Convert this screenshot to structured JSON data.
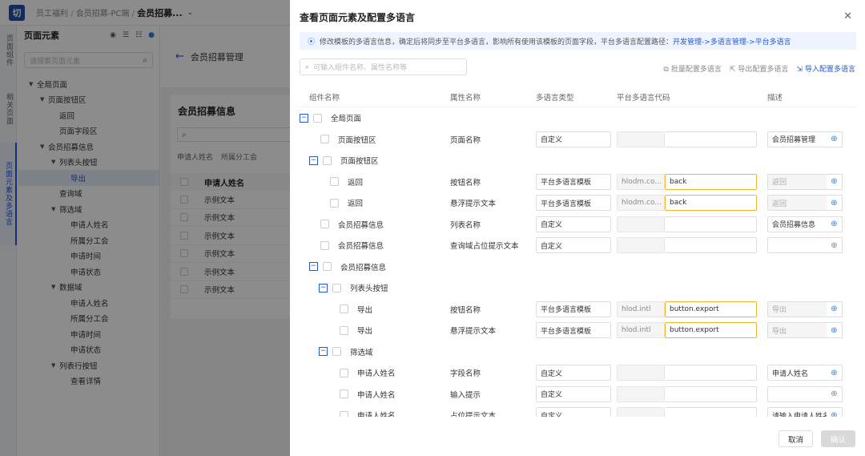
{
  "topbar": {
    "logo": "切",
    "breadcrumb": [
      "员工福利",
      "会员招募-PC端"
    ],
    "current": "会员招募..."
  },
  "vtabs": [
    {
      "label": "页面组件",
      "active": false
    },
    {
      "label": "相关页面",
      "active": false
    },
    {
      "label": "页面元素及多语言",
      "active": true
    }
  ],
  "tree": {
    "title": "页面元素",
    "search_placeholder": "请搜索页面元素",
    "nodes": [
      {
        "label": "全局页面",
        "level": 0,
        "arrow": "▼"
      },
      {
        "label": "页面按钮区",
        "level": 1,
        "arrow": "▼"
      },
      {
        "label": "返回",
        "level": 2,
        "arrow": ""
      },
      {
        "label": "页面字段区",
        "level": 2,
        "arrow": ""
      },
      {
        "label": "会员招募信息",
        "level": 1,
        "arrow": "▼"
      },
      {
        "label": "列表头按钮",
        "level": 2,
        "arrow": "▼"
      },
      {
        "label": "导出",
        "level": 3,
        "arrow": "",
        "selected": true
      },
      {
        "label": "查询域",
        "level": 2,
        "arrow": ""
      },
      {
        "label": "筛选域",
        "level": 2,
        "arrow": "▼"
      },
      {
        "label": "申请人姓名",
        "level": 3,
        "arrow": ""
      },
      {
        "label": "所属分工会",
        "level": 3,
        "arrow": ""
      },
      {
        "label": "申请时间",
        "level": 3,
        "arrow": ""
      },
      {
        "label": "申请状态",
        "level": 3,
        "arrow": ""
      },
      {
        "label": "数据域",
        "level": 2,
        "arrow": "▼"
      },
      {
        "label": "申请人姓名",
        "level": 3,
        "arrow": ""
      },
      {
        "label": "所属分工会",
        "level": 3,
        "arrow": ""
      },
      {
        "label": "申请时间",
        "level": 3,
        "arrow": ""
      },
      {
        "label": "申请状态",
        "level": 3,
        "arrow": ""
      },
      {
        "label": "列表行按钮",
        "level": 2,
        "arrow": "▼"
      },
      {
        "label": "查看详情",
        "level": 3,
        "arrow": ""
      }
    ]
  },
  "main": {
    "page_title": "会员招募管理",
    "card_title": "会员招募信息",
    "filters": [
      "申请人姓名",
      "所属分工会"
    ],
    "table_header": "申请人姓名",
    "rows": [
      "示例文本",
      "示例文本",
      "示例文本",
      "示例文本",
      "示例文本",
      "示例文本"
    ]
  },
  "drawer": {
    "title": "查看页面元素及配置多语言",
    "notice": "修改模板的多语言信息，确定后将同步至平台多语言，影响所有使用该模板的页面字段，平台多语言配置路径：",
    "notice_path": "开发管理->多语言管理->平台多语言",
    "search_placeholder": "可输入组件名称、属性名称等",
    "actions": {
      "batch": "批量配置多语言",
      "export": "导出配置多语言",
      "import": "导入配置多语言"
    },
    "columns": [
      "组件名称",
      "属性名称",
      "多语言类型",
      "平台多语言代码",
      "描述"
    ],
    "rows": [
      {
        "type": "group",
        "indent": 0,
        "name": "全局页面"
      },
      {
        "type": "item",
        "indent": 1,
        "name": "页面按钮区",
        "attr": "页面名称",
        "lang": "自定义",
        "code": "",
        "val": "",
        "hl": false,
        "desc": "会员招募管理",
        "desc_dis": false,
        "globe_blue": true
      },
      {
        "type": "group",
        "indent": 1,
        "name": "页面按钮区"
      },
      {
        "type": "item",
        "indent": 2,
        "name": "返回",
        "attr": "按钮名称",
        "lang": "平台多语言模板",
        "code": "hlodm.co...",
        "val": "back",
        "hl": true,
        "desc": "返回",
        "desc_dis": true,
        "globe_blue": true
      },
      {
        "type": "item",
        "indent": 2,
        "name": "返回",
        "attr": "悬浮提示文本",
        "lang": "平台多语言模板",
        "code": "hlodm.co...",
        "val": "back",
        "hl": true,
        "desc": "返回",
        "desc_dis": true,
        "globe_blue": true
      },
      {
        "type": "item",
        "indent": 1,
        "name": "会员招募信息",
        "attr": "列表名称",
        "lang": "自定义",
        "code": "",
        "val": "",
        "hl": false,
        "desc": "会员招募信息",
        "desc_dis": false,
        "globe_blue": true
      },
      {
        "type": "item",
        "indent": 1,
        "name": "会员招募信息",
        "attr": "查询域占位提示文本",
        "lang": "自定义",
        "code": "",
        "val": "",
        "hl": false,
        "desc": "",
        "desc_dis": false,
        "globe_blue": false
      },
      {
        "type": "group",
        "indent": 1,
        "name": "会员招募信息"
      },
      {
        "type": "group",
        "indent": 2,
        "name": "列表头按钮"
      },
      {
        "type": "item",
        "indent": 3,
        "name": "导出",
        "attr": "按钮名称",
        "lang": "平台多语言模板",
        "code": "hlod.intl",
        "val": "button.export",
        "hl": true,
        "desc": "导出",
        "desc_dis": true,
        "globe_blue": true
      },
      {
        "type": "item",
        "indent": 3,
        "name": "导出",
        "attr": "悬浮提示文本",
        "lang": "平台多语言模板",
        "code": "hlod.intl",
        "val": "button.export",
        "hl": true,
        "desc": "导出",
        "desc_dis": true,
        "globe_blue": true
      },
      {
        "type": "group",
        "indent": 2,
        "name": "筛选域"
      },
      {
        "type": "item",
        "indent": 3,
        "name": "申请人姓名",
        "attr": "字段名称",
        "lang": "自定义",
        "code": "",
        "val": "",
        "hl": false,
        "desc": "申请人姓名",
        "desc_dis": false,
        "globe_blue": true
      },
      {
        "type": "item",
        "indent": 3,
        "name": "申请人姓名",
        "attr": "输入提示",
        "lang": "自定义",
        "code": "",
        "val": "",
        "hl": false,
        "desc": "",
        "desc_dis": false,
        "globe_blue": false
      },
      {
        "type": "item",
        "indent": 3,
        "name": "申请人姓名",
        "attr": "占位提示文本",
        "lang": "自定义",
        "code": "",
        "val": "",
        "hl": false,
        "desc": "请输入申请人姓名",
        "desc_dis": false,
        "globe_blue": true
      }
    ],
    "cancel": "取消",
    "ok": "确认"
  }
}
